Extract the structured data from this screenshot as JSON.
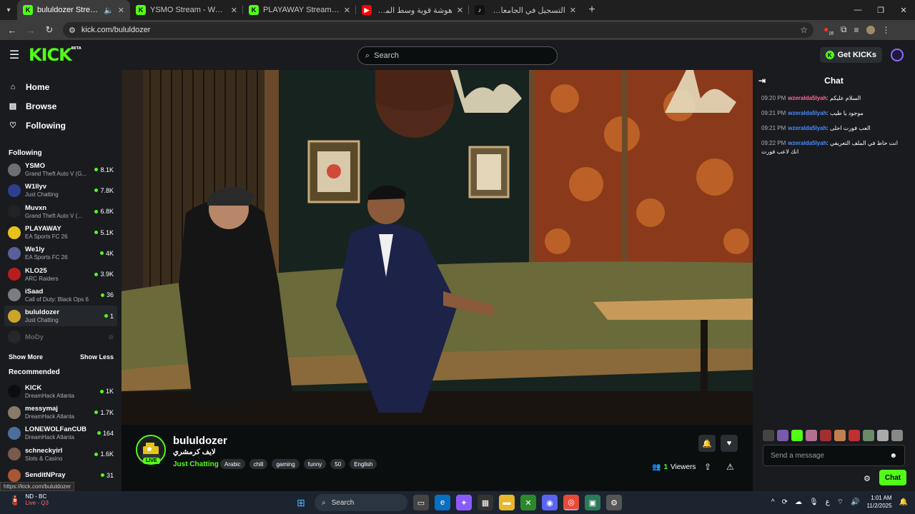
{
  "browser": {
    "tabs": [
      {
        "title": "bululdozer Stream - Watch",
        "favicon": "kick",
        "active": true
      },
      {
        "title": "YSMO Stream - Watch Live on",
        "favicon": "kick",
        "active": false
      },
      {
        "title": "PLAYAWAY Stream - Watch Live",
        "favicon": "kick",
        "active": false
      },
      {
        "title": "هوشة قوية وسط المباراة",
        "favicon": "youtube",
        "active": false
      },
      {
        "title": "التسجيل في الجامعات (@sajjel)",
        "favicon": "tiktok",
        "active": false
      }
    ],
    "url": "kick.com/bululdozer",
    "ext_badge": "16"
  },
  "header": {
    "logo": "KICK",
    "logo_badge": "BETA",
    "search_placeholder": "Search",
    "get_kicks": "Get KICKs"
  },
  "sidebar": {
    "nav": [
      {
        "label": "Home",
        "icon": "home-icon"
      },
      {
        "label": "Browse",
        "icon": "browse-icon"
      },
      {
        "label": "Following",
        "icon": "heart-icon"
      }
    ],
    "following_title": "Following",
    "following": [
      {
        "name": "YSMO",
        "category": "Grand Theft Auto V (G...",
        "viewers": "8.1K",
        "color": "#6d6f75"
      },
      {
        "name": "W1llyv",
        "category": "Just Chatting",
        "viewers": "7.8K",
        "color": "#2f3f8f"
      },
      {
        "name": "Muvxn",
        "category": "Grand Theft Auto V (...",
        "viewers": "6.8K",
        "color": "#222"
      },
      {
        "name": "PLAYAWAY",
        "category": "EA Sports FC 26",
        "viewers": "5.1K",
        "color": "#e6c21a"
      },
      {
        "name": "We1ly",
        "category": "EA Sports FC 26",
        "viewers": "4K",
        "color": "#5a5e9a"
      },
      {
        "name": "KLO25",
        "category": "ARC Raiders",
        "viewers": "3.9K",
        "color": "#b81d1d"
      },
      {
        "name": "iSaad",
        "category": "Call of Duty: Black Ops 6",
        "viewers": "36",
        "color": "#7a7d84"
      },
      {
        "name": "bululdozer",
        "category": "Just Chatting",
        "viewers": "1",
        "color": "#caa52a"
      }
    ],
    "offline": {
      "name": "MoDy"
    },
    "show_more": "Show More",
    "show_less": "Show Less",
    "recommended_title": "Recommended",
    "recommended": [
      {
        "name": "KICK",
        "category": "DreamHack Atlanta",
        "viewers": "1K",
        "color": "#0b0e0f"
      },
      {
        "name": "messymaj",
        "category": "DreamHack Atlanta",
        "viewers": "1.7K",
        "color": "#8a7a6a"
      },
      {
        "name": "LONEWOLFanCUB",
        "category": "DreamHack Atlanta",
        "viewers": "164",
        "color": "#4b6f9a"
      },
      {
        "name": "schneckyirl",
        "category": "Slots & Casino",
        "viewers": "1.6K",
        "color": "#7a5a4a"
      },
      {
        "name": "SenditNPray",
        "category": "",
        "viewers": "31",
        "color": "#aa5533"
      }
    ],
    "status_url": "https://kick.com/bululdozer"
  },
  "stream": {
    "channel": "bululdozer",
    "title": "لايف كرمشري",
    "category": "Just Chatting",
    "live_label": "LIVE",
    "tags": [
      "Arabic",
      "chill",
      "gaming",
      "funny",
      "50",
      "English"
    ],
    "viewers_count": "1",
    "viewers_label": "Viewers"
  },
  "chat": {
    "title": "Chat",
    "messages": [
      {
        "time": "09:20 PM",
        "user": "wzeralda5lyah",
        "color": "#ff6b9a",
        "text": "السلام عليكم"
      },
      {
        "time": "09:21 PM",
        "user": "wzeralda5lyah",
        "color": "#4a8cff",
        "text": "موجود يا طيب"
      },
      {
        "time": "09:21 PM",
        "user": "wzeralda5lyah",
        "color": "#4a8cff",
        "text": "العب فورت احلى"
      },
      {
        "time": "09:22 PM",
        "user": "wzeralda5lyah",
        "color": "#4a8cff",
        "text": "انت حاط في الملف التعريفي انك لاعب فورت"
      }
    ],
    "input_placeholder": "Send a message",
    "send_label": "Chat"
  },
  "taskbar": {
    "weather_line1": "ND - BC",
    "weather_line2": "Live - Q3",
    "search": "Search",
    "time": "1:01 AM",
    "date": "11/2/2025"
  }
}
